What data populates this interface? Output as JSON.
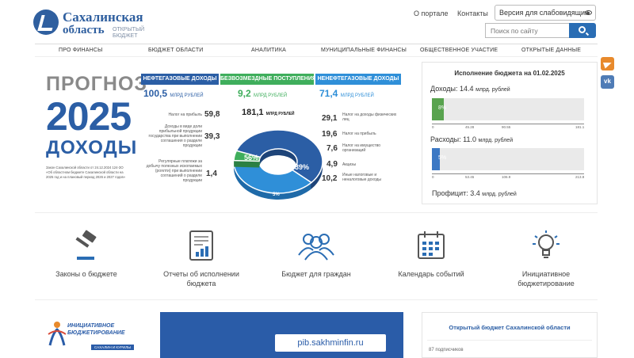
{
  "header": {
    "logo_line1": "Сахалинская",
    "logo_line2": "область",
    "logo_sub": "открытый бюджет",
    "links": [
      "О портале",
      "Контакты"
    ],
    "vision_label": "Версия для слабовидящих",
    "search_placeholder": "Поиск по сайту"
  },
  "nav": [
    "Про финансы",
    "Бюджет области",
    "Аналитика",
    "Муниципальные финансы",
    "Общественное участие",
    "Открытые данные"
  ],
  "banner": {
    "prognoz": "ПРОГНОЗ",
    "year": "2025",
    "dohody": "ДОХОДЫ",
    "law_text": "Закон Сахалинской области от 24.12.2024 124-ЗО «Об областном бюджете Сахалинской области на 2025 год и на плановый период 2026 и 2027 годов»",
    "tabs": [
      "НЕФТЕГАЗОВЫЕ ДОХОДЫ",
      "БЕЗВОЗМЕЗДНЫЕ ПОСТУПЛЕНИЯ",
      "НЕНЕФТЕГАЗОВЫЕ ДОХОДЫ"
    ],
    "values": [
      {
        "num": "100,5",
        "unit": "МЛРД РУБЛЕЙ"
      },
      {
        "num": "9,2",
        "unit": "МЛРД РУБЛЕЙ"
      },
      {
        "num": "71,4",
        "unit": "МЛРД РУБЛЕЙ"
      }
    ],
    "left_rows": [
      {
        "label": "Налог на прибыль",
        "value": "59,8"
      },
      {
        "label": "Доходы в виде доли прибыльной продукции государства при выполнении соглашения о разделе продукции",
        "value": "39,3"
      },
      {
        "label": "Регулярные платежи за добычу полезных ископаемых (роялти) при выполнении соглашений о разделе продукции",
        "value": "1,4"
      }
    ],
    "right_rows": [
      {
        "label": "Налог на доходы физических лиц",
        "value": "29,1"
      },
      {
        "label": "Налог на прибыль",
        "value": "19,6"
      },
      {
        "label": "Налог на имущество организаций",
        "value": "7,6"
      },
      {
        "label": "Акцизы",
        "value": "4,9"
      },
      {
        "label": "Иные налоговые и неналоговые доходы",
        "value": "10,2"
      }
    ],
    "donut_total": "181,1",
    "donut_unit": "МЛРД РУБЛЕЙ",
    "donut": {
      "oil_gas_pct": 56,
      "non_oil_pct": 39,
      "free_pct": 5
    },
    "donut_labels": [
      "56%",
      "39%",
      "5%"
    ]
  },
  "execution": {
    "title": "Исполнение бюджета на 01.02.2025",
    "income_label": "Доходы:",
    "income_value": "14.4",
    "income_unit": "млрд. рублей",
    "income_fraction": 0.08,
    "income_pct_label": "8%",
    "income_ticks": [
      "0",
      "45.28",
      "90.55",
      "181.1"
    ],
    "expense_label": "Расходы:",
    "expense_value": "11.0",
    "expense_unit": "млрд. рублей",
    "expense_fraction": 0.05,
    "expense_pct_label": "5%",
    "expense_ticks": [
      "0",
      "53.45",
      "106.9",
      "213.8"
    ],
    "profit_label": "Профицит:",
    "profit_value": "3.4",
    "profit_unit": "млрд. рублей"
  },
  "quick_links": [
    {
      "label": "Законы о бюджете",
      "icon": "gavel-icon"
    },
    {
      "label": "Отчеты об исполнении бюджета",
      "icon": "report-icon"
    },
    {
      "label": "Бюджет для граждан",
      "icon": "people-icon"
    },
    {
      "label": "Календарь событий",
      "icon": "calendar-icon"
    },
    {
      "label": "Инициативное бюджетирование",
      "icon": "lightbulb-icon"
    }
  ],
  "promo": {
    "brand1": "ИНИЦИАТИВНОЕ",
    "brand2": "БЮДЖЕТИРОВАНИЕ",
    "tag": "САХАЛИН И КУРИЛЫ",
    "url": "pib.sakhminfin.ru"
  },
  "open_budget": {
    "title": "Открытый бюджет Сахалинской области",
    "subscribers": "87 подписчиков"
  },
  "social": [
    "telegram-icon",
    "vk-icon"
  ],
  "colors": {
    "primary": "#2b5ea5",
    "green": "#58a34e",
    "accent_blue": "#2a6db4",
    "orange": "#e88a2c"
  }
}
